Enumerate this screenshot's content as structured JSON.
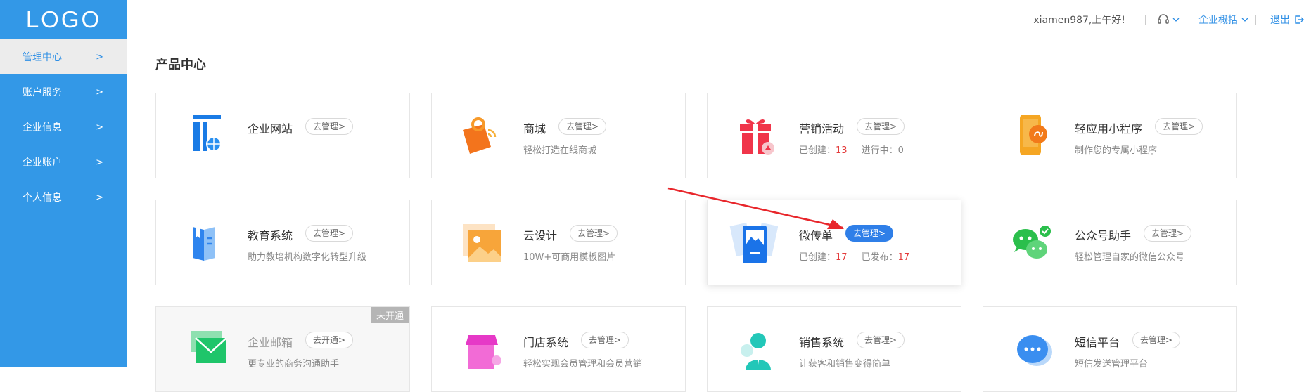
{
  "logo": "LOGO",
  "sidebar": {
    "items": [
      {
        "label": "管理中心",
        "active": true
      },
      {
        "label": "账户服务"
      },
      {
        "label": "企业信息"
      },
      {
        "label": "企业账户"
      },
      {
        "label": "个人信息"
      }
    ],
    "chevron": ">"
  },
  "topbar": {
    "greeting": "xiamen987,上午好!",
    "headset_icon": "headset-icon",
    "overview_label": "企业概括",
    "logout_label": "退出",
    "logout_icon": "logout-icon"
  },
  "page_title": "产品中心",
  "cards": [
    {
      "name": "企业网站",
      "action": "去管理>",
      "desc": "",
      "icon": "website-icon"
    },
    {
      "name": "商城",
      "action": "去管理>",
      "desc": "轻松打造在线商城",
      "icon": "shopping-bag-icon"
    },
    {
      "name": "营销活动",
      "action": "去管理>",
      "stats": [
        {
          "label": "已创建：",
          "value": "13",
          "highlight": true
        },
        {
          "label": "进行中：",
          "value": "0"
        }
      ],
      "icon": "gift-icon"
    },
    {
      "name": "轻应用小程序",
      "action": "去管理>",
      "desc": "制作您的专属小程序",
      "icon": "mini-program-icon"
    },
    {
      "name": "教育系统",
      "action": "去管理>",
      "desc": "助力教培机构数字化转型升级",
      "icon": "book-icon"
    },
    {
      "name": "云设计",
      "action": "去管理>",
      "desc": "10W+可商用模板图片",
      "icon": "image-design-icon"
    },
    {
      "name": "微传单",
      "action": "去管理>",
      "stats": [
        {
          "label": "已创建：",
          "value": "17",
          "highlight": true
        },
        {
          "label": "已发布：",
          "value": "17",
          "highlight": true
        }
      ],
      "icon": "flyer-icon",
      "highlighted": true
    },
    {
      "name": "公众号助手",
      "action": "去管理>",
      "desc": "轻松管理自家的微信公众号",
      "icon": "wechat-icon"
    },
    {
      "name": "企业邮箱",
      "action": "去开通>",
      "desc": "更专业的商务沟通助手",
      "icon": "mail-icon",
      "disabled": true,
      "badge": "未开通"
    },
    {
      "name": "门店系统",
      "action": "去管理>",
      "desc": "轻松实现会员管理和会员营销",
      "icon": "store-icon"
    },
    {
      "name": "销售系统",
      "action": "去管理>",
      "desc": "让获客和销售变得简单",
      "icon": "sales-person-icon"
    },
    {
      "name": "短信平台",
      "action": "去管理>",
      "desc": "短信发送管理平台",
      "icon": "sms-icon"
    }
  ],
  "colors": {
    "sidebar_bg": "#3398e7",
    "accent": "#2f7fe8",
    "stat_red": "#e43b3b",
    "annotation_arrow": "#e8262b"
  }
}
